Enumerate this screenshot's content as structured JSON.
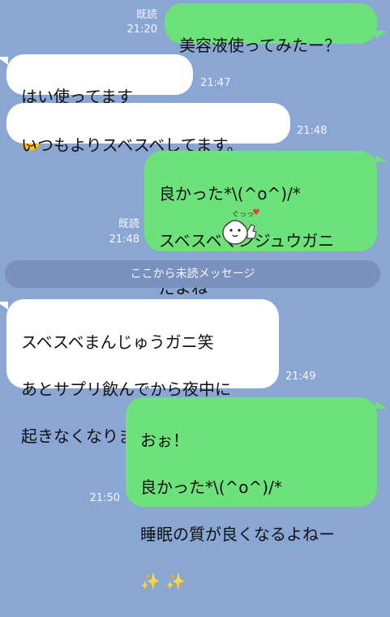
{
  "messages": [
    {
      "id": "m1",
      "side": "me",
      "text": "美容液使ってみたー？",
      "read_label": "既読",
      "time": "21:20"
    },
    {
      "id": "m2",
      "side": "them",
      "text": "はい使ってます",
      "emoji": "smiling-face-icon",
      "time": "21:47"
    },
    {
      "id": "m3",
      "side": "them",
      "text": "いつもよりスベスベしてます。",
      "time": "21:48"
    },
    {
      "id": "m4",
      "side": "me",
      "lines": [
        "良かった*\\(^o^)/*",
        "スベスベマンジュウガニ",
        "だよね"
      ],
      "sticker": "thumbs-up-character-icon",
      "sticker_text": "ぐっっ",
      "read_label": "既読",
      "time": "21:48"
    },
    {
      "id": "m5",
      "side": "them",
      "lines": [
        "スベスベまんじゅうガニ笑",
        "あとサプリ飲んでから夜中に",
        "起きなくなりました。"
      ],
      "time": "21:49"
    },
    {
      "id": "m6",
      "side": "me",
      "lines": [
        "おぉ！",
        "良かった*\\(^o^)/*",
        "睡眠の質が良くなるよねー"
      ],
      "trailing": "sparkles-icon",
      "time": "21:50"
    }
  ],
  "divider": {
    "label": "ここから未読メッセージ"
  }
}
